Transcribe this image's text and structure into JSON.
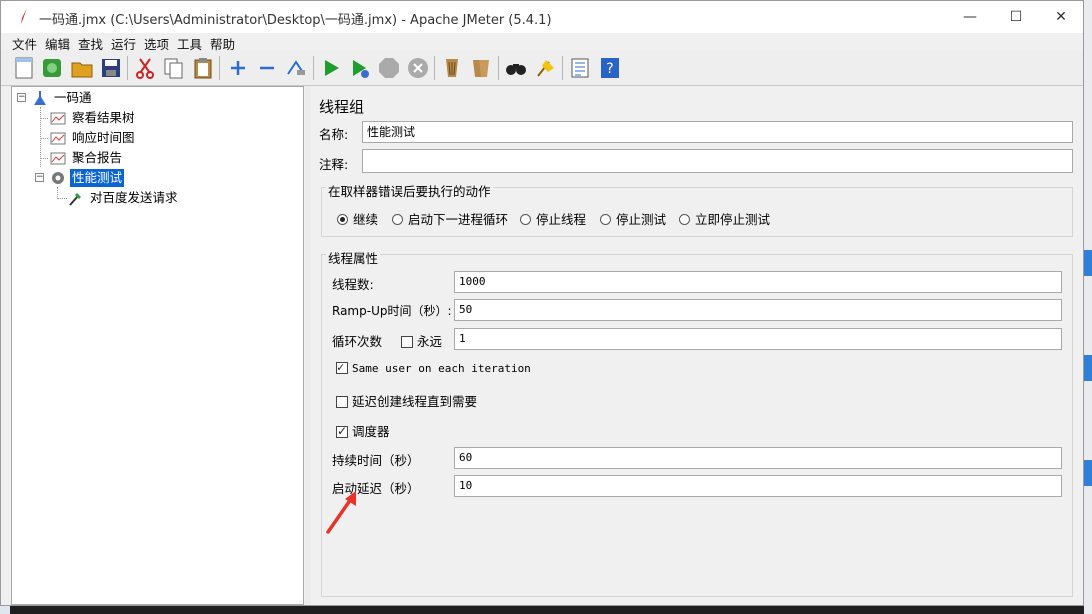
{
  "window": {
    "title": "一码通.jmx (C:\\Users\\Administrator\\Desktop\\一码通.jmx) - Apache JMeter (5.4.1)",
    "controls": {
      "minimize": "—",
      "maximize": "☐",
      "close": "✕"
    }
  },
  "menu": [
    "文件",
    "编辑",
    "查找",
    "运行",
    "选项",
    "工具",
    "帮助"
  ],
  "toolbar_icons": [
    "new-icon",
    "templates-icon",
    "open-icon",
    "save-icon",
    "cut-icon",
    "copy-icon",
    "paste-icon",
    "expand-icon",
    "collapse-icon",
    "toggle-icon",
    "start-icon",
    "start-no-pause-icon",
    "stop-icon",
    "shutdown-icon",
    "clear-icon",
    "clear-all-icon",
    "search-icon",
    "reset-search-icon",
    "function-helper-icon",
    "help-icon"
  ],
  "tree": {
    "root": "一码通",
    "children": [
      "察看结果树",
      "响应时间图",
      "聚合报告"
    ],
    "selected": "性能测试",
    "sampler": "对百度发送请求"
  },
  "thread_group": {
    "heading": "线程组",
    "name_label": "名称:",
    "name_value": "性能测试",
    "comment_label": "注释:",
    "comment_value": "",
    "error_action": {
      "title": "在取样器错误后要执行的动作",
      "options": [
        "继续",
        "启动下一进程循环",
        "停止线程",
        "停止测试",
        "立即停止测试"
      ],
      "selected_index": 0
    },
    "props": {
      "title": "线程属性",
      "threads_label": "线程数:",
      "threads_value": "1000",
      "rampup_label": "Ramp-Up时间（秒）:",
      "rampup_value": "50",
      "loop_label": "循环次数",
      "forever_label": "永远",
      "loop_value": "1",
      "same_user_label": "Same user on each iteration",
      "delay_create_label": "延迟创建线程直到需要",
      "scheduler_label": "调度器",
      "duration_label": "持续时间（秒）",
      "duration_value": "60",
      "startup_delay_label": "启动延迟（秒）",
      "startup_delay_value": "10"
    }
  },
  "colors": {
    "selection": "#0b64d6",
    "annotation_arrow": "#e8322a"
  }
}
